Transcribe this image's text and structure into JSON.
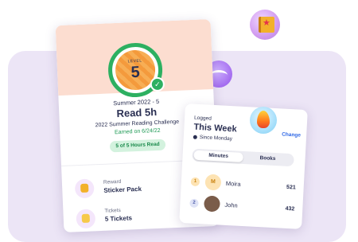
{
  "level": {
    "label": "LEVEL",
    "number": "5"
  },
  "main_card": {
    "season": "Summer 2022 - 5",
    "title": "Read 5h",
    "challenge": "2022 Summer Reading Challenge",
    "earned": "Earned on 6/24/22",
    "progress": "5 of 5 Hours Read",
    "reward": {
      "label": "Reward",
      "value": "Sticker Pack"
    },
    "tickets": {
      "label": "Tickets",
      "value": "5 Tickets"
    }
  },
  "week_card": {
    "logged": "Logged",
    "title": "This Week",
    "change": "Change",
    "since": "Since Monday",
    "tabs": [
      "Minutes",
      "Books"
    ],
    "active_tab": "Minutes",
    "rows": [
      {
        "rank": "1",
        "initial": "M",
        "name": "Moira",
        "score": "521"
      },
      {
        "rank": "2",
        "initial": "",
        "name": "John",
        "score": "432"
      }
    ]
  },
  "colors": {
    "accent_green": "#2db061",
    "link_blue": "#2f68e6",
    "panel_lavender": "#ece5f6"
  },
  "icons": [
    "book-badge-icon",
    "reading-badge-icon",
    "flame-badge-icon",
    "trophy-icon",
    "ticket-icon",
    "check-icon",
    "clock-icon"
  ]
}
